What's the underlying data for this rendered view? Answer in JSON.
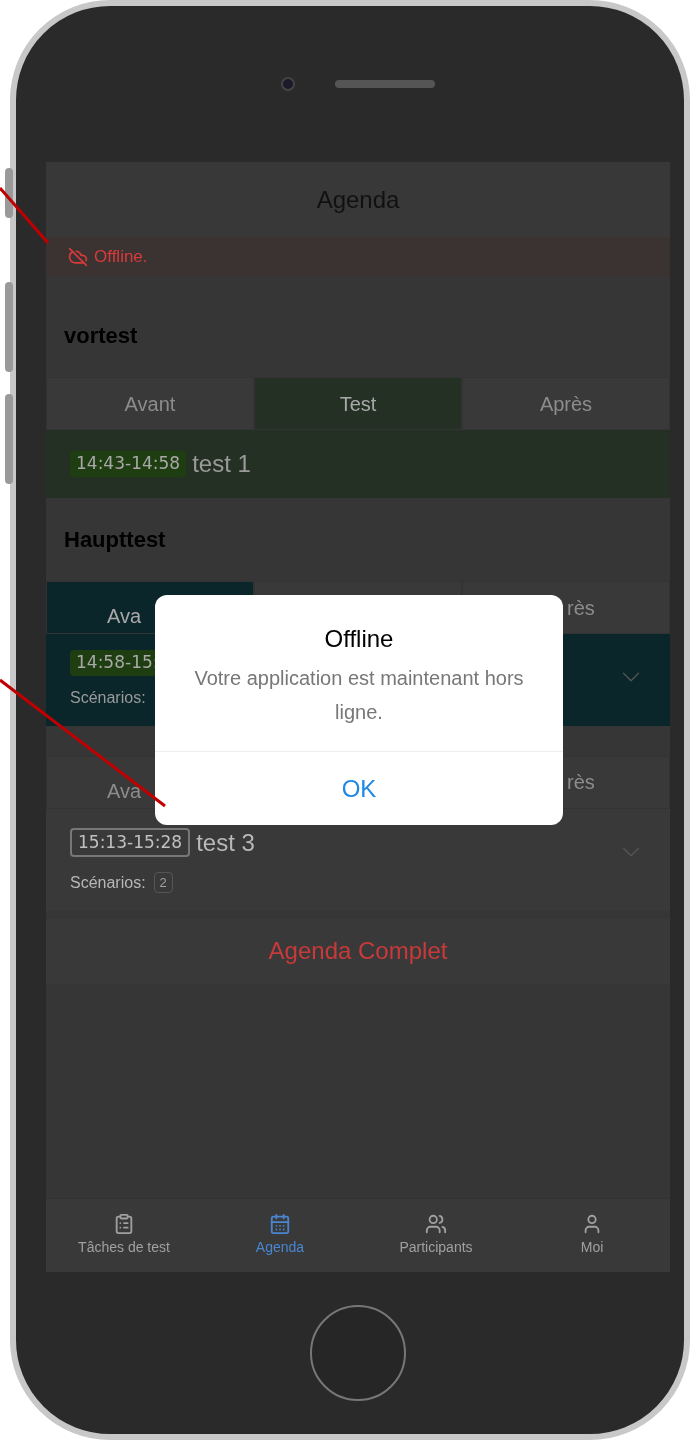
{
  "screen": {
    "title": "Agenda",
    "offline_banner": "Offline.",
    "sections": [
      {
        "title": "vortest",
        "groups": [
          {
            "color": "#243024",
            "tabs": [
              {
                "label": "Avant",
                "selected": false
              },
              {
                "label": "Test",
                "selected": true
              },
              {
                "label": "Après",
                "selected": false
              }
            ],
            "item": {
              "time": "14:43-14:58",
              "title": "test 1",
              "active": true,
              "expandable": false
            }
          }
        ]
      },
      {
        "title": "Haupttest",
        "groups": [
          {
            "color": "#0a262b",
            "tabs": [
              {
                "label": "Ava",
                "selected": true
              },
              {
                "label": "rès",
                "selected": false
              }
            ],
            "item": {
              "time": "14:58-15:",
              "scenarios_label": "Scénarios:",
              "active": true,
              "expandable": true
            }
          },
          {
            "tabs": [
              {
                "label": "Ava",
                "selected": false
              },
              {
                "label": "rès",
                "selected": false
              }
            ],
            "item": {
              "time": "15:13-15:28",
              "title": "test 3",
              "scenarios_label": "Scénarios:",
              "scenarios_count": "2",
              "active": false,
              "expandable": true
            }
          }
        ]
      }
    ],
    "footer_button": "Agenda Complet"
  },
  "tab_bar": [
    {
      "kind": "tasks",
      "label": "Tâches de test",
      "selected": false
    },
    {
      "kind": "calendar",
      "label": "Agenda",
      "selected": true
    },
    {
      "kind": "people",
      "label": "Participants",
      "selected": false
    },
    {
      "kind": "person",
      "label": "Moi",
      "selected": false
    }
  ],
  "dialog": {
    "title": "Offline",
    "message": "Votre application est maintenant hors ligne.",
    "button": "OK"
  }
}
